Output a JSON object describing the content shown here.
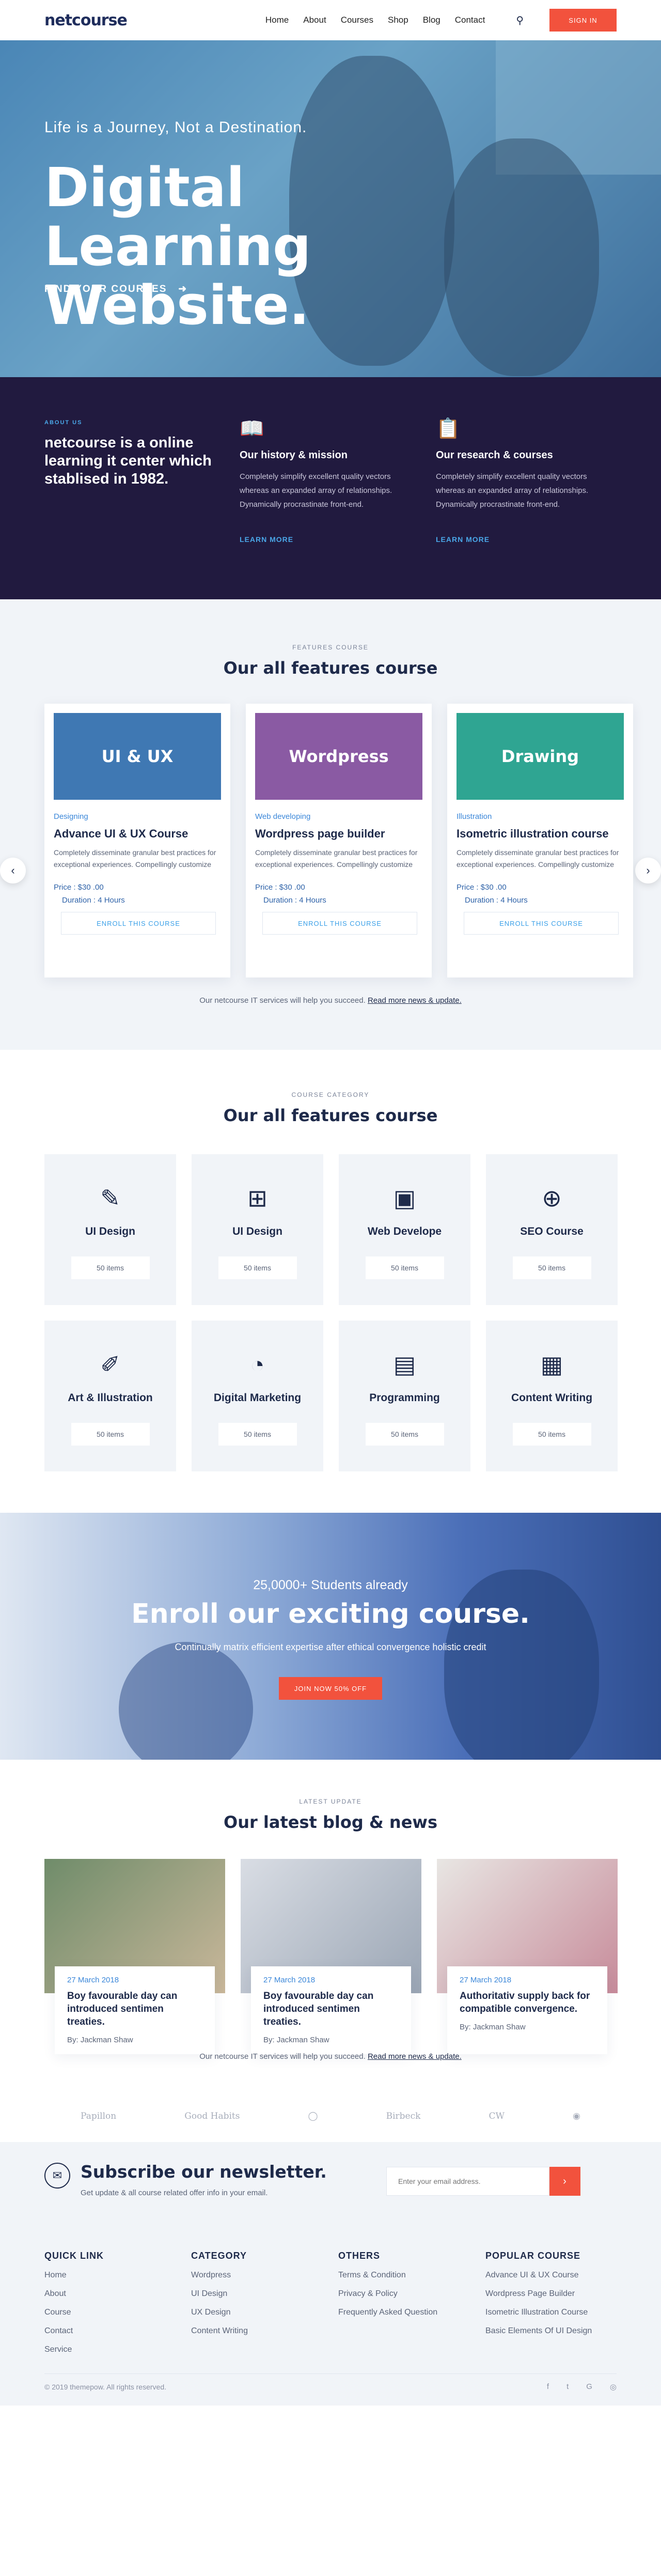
{
  "header": {
    "logo": "netcourse",
    "menu": [
      "Home",
      "About",
      "Courses",
      "Shop",
      "Blog",
      "Contact"
    ],
    "signin": "SIGN IN"
  },
  "hero": {
    "subtitle": "Life is a Journey, Not a Destination.",
    "title": "Digital Learning Website.",
    "cta": "FIND YOUR COURSES"
  },
  "about": {
    "label": "ABOUT US",
    "headline": "netcourse is a online learning it center which stablised in 1982.",
    "cols": [
      {
        "title": "Our history & mission",
        "text": "Completely simplify excellent quality vectors whereas an expanded array of relationships. Dynamically procrastinate front-end.",
        "more": "LEARN MORE"
      },
      {
        "title": "Our research & courses",
        "text": "Completely simplify excellent quality vectors whereas an expanded array of relationships. Dynamically procrastinate front-end.",
        "more": "LEARN MORE"
      }
    ]
  },
  "features": {
    "label": "FEATURES COURSE",
    "heading": "Our all features course",
    "cards": [
      {
        "thumb": "UI & UX",
        "category": "Designing",
        "title": "Advance UI & UX Course",
        "text": "Completely disseminate granular best practices for exceptional experiences. Compellingly customize",
        "price": "Price : $30 .00",
        "duration": "Duration : 4 Hours",
        "button": "ENROLL THIS COURSE",
        "color": "#3f78b3"
      },
      {
        "thumb": "Wordpress",
        "category": "Web developing",
        "title": "Wordpress page builder",
        "text": "Completely disseminate granular best practices for exceptional experiences. Compellingly customize",
        "price": "Price : $30 .00",
        "duration": "Duration : 4 Hours",
        "button": "ENROLL THIS COURSE",
        "color": "#8a5aa3"
      },
      {
        "thumb": "Drawing",
        "category": "Illustration",
        "title": "Isometric illustration course",
        "text": "Completely disseminate granular best practices for exceptional experiences. Compellingly customize",
        "price": "Price : $30 .00",
        "duration": "Duration : 4 Hours",
        "button": "ENROLL THIS COURSE",
        "color": "#2fa592"
      }
    ],
    "help_text": "Our netcourse IT services will help you succeed.",
    "help_link": "Read more news & update."
  },
  "categories": {
    "label": "COURSE CATEGORY",
    "heading": "Our all features course",
    "items": [
      {
        "icon": "✎",
        "title": "UI Design",
        "count": "50 items"
      },
      {
        "icon": "⊞",
        "title": "UI Design",
        "count": "50 items"
      },
      {
        "icon": "▣",
        "title": "Web Develope",
        "count": "50 items"
      },
      {
        "icon": "⊕",
        "title": "SEO Course",
        "count": "50 items"
      },
      {
        "icon": "✐",
        "title": "Art & Illustration",
        "count": "50 items"
      },
      {
        "icon": "◔",
        "title": "Digital Marketing",
        "count": "50 items"
      },
      {
        "icon": "▤",
        "title": "Programming",
        "count": "50 items"
      },
      {
        "icon": "▦",
        "title": "Content Writing",
        "count": "50 items"
      }
    ]
  },
  "enroll": {
    "students": "25,0000+ Students already",
    "title": "Enroll our exciting course.",
    "text": "Continually matrix efficient expertise after ethical convergence holistic credit",
    "button": "JOIN NOW 50% OFF"
  },
  "blog": {
    "label": "LATEST UPDATE",
    "heading": "Our latest blog & news",
    "posts": [
      {
        "date": "27 March 2018",
        "title": "Boy favourable day can introduced sentimen treaties.",
        "author": "By: Jackman Shaw"
      },
      {
        "date": "27 March 2018",
        "title": "Boy favourable day can introduced sentimen treaties.",
        "author": "By: Jackman Shaw"
      },
      {
        "date": "27 March 2018",
        "title": "Authoritativ supply back for compatible convergence.",
        "author": "By: Jackman Shaw"
      }
    ],
    "help_text": "Our netcourse IT services will help you succeed.",
    "help_link": "Read more news & update."
  },
  "brands": [
    "Papillon",
    "Good Habits",
    "",
    "Birbeck",
    "CW",
    ""
  ],
  "newsletter": {
    "title": "Subscribe our newsletter.",
    "text": "Get update & all course related offer info in your email.",
    "placeholder": "Enter your email address.",
    "button": "›"
  },
  "footer": {
    "cols": [
      {
        "title": "QUICK LINK",
        "items": [
          "Home",
          "About",
          "Course",
          "Contact",
          "Service"
        ]
      },
      {
        "title": "CATEGORY",
        "items": [
          "Wordpress",
          "UI Design",
          "UX Design",
          "Content Writing"
        ]
      },
      {
        "title": "OTHERS",
        "items": [
          "Terms & Condition",
          "Privacy & Policy",
          "Frequently Asked Question"
        ]
      },
      {
        "title": "POPULAR COURSE",
        "items": [
          "Advance UI & UX Course",
          "Wordpress Page Builder",
          "Isometric Illustration Course",
          "Basic Elements Of UI Design"
        ]
      }
    ],
    "copyright": "© 2019 themepow. All rights reserved.",
    "social": [
      "f",
      "t",
      "G",
      "◎"
    ]
  }
}
